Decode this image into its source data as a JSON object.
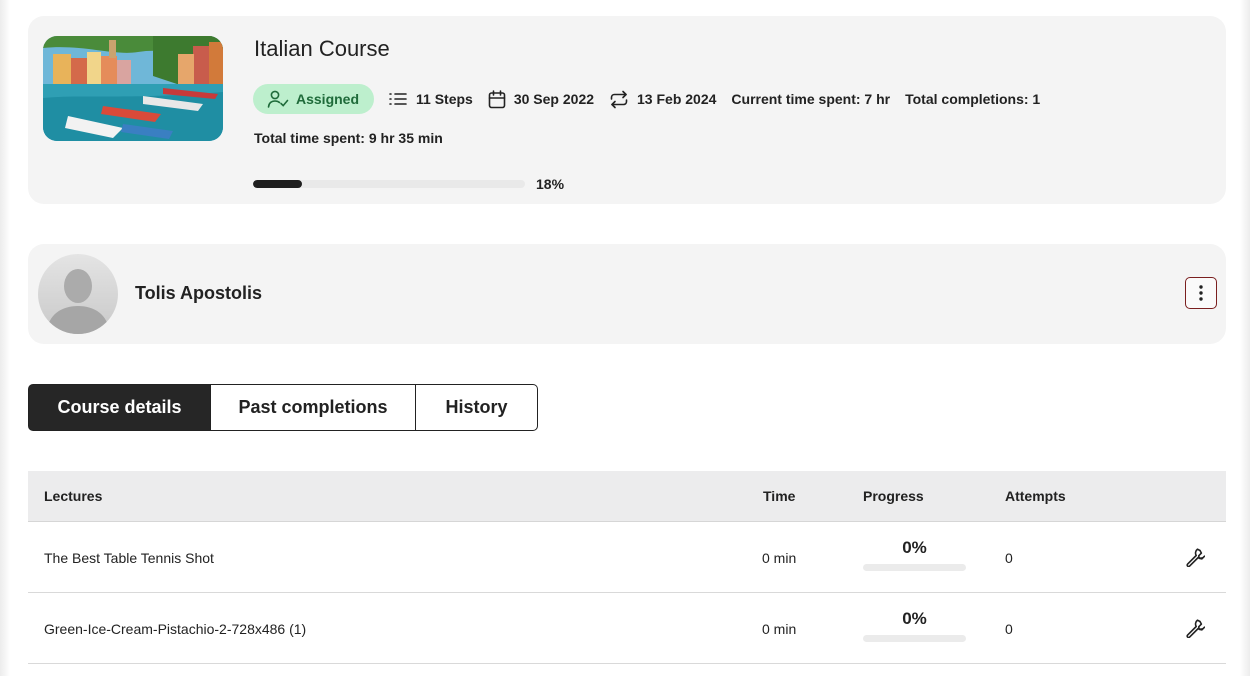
{
  "course": {
    "title": "Italian Course",
    "status_badge": "Assigned",
    "steps": "11 Steps",
    "start_date": "30 Sep 2022",
    "renew_date": "13 Feb 2024",
    "current_time_spent": "Current time spent: 7 hr",
    "total_completions": "Total completions: 1",
    "total_time_spent": "Total time spent: 9 hr 35 min",
    "progress_percent": 18,
    "progress_label": "18%",
    "icons": [
      "user-check-icon",
      "list-icon",
      "calendar-icon",
      "repeat-icon"
    ],
    "badge_color": "#bdefcd"
  },
  "user": {
    "name": "Tolis Apostolis",
    "menu_icon": "kebab-menu-icon"
  },
  "tabs": [
    {
      "label": "Course details",
      "active": true
    },
    {
      "label": "Past completions",
      "active": false
    },
    {
      "label": "History",
      "active": false
    }
  ],
  "table": {
    "headers": {
      "lectures": "Lectures",
      "time": "Time",
      "progress": "Progress",
      "attempts": "Attempts"
    },
    "rows": [
      {
        "name": "The Best Table Tennis Shot",
        "time": "0 min",
        "progress": "0%",
        "progress_value": 0,
        "attempts": "0",
        "action_icon": "wrench-icon"
      },
      {
        "name": "Green-Ice-Cream-Pistachio-2-728x486 (1)",
        "time": "0 min",
        "progress": "0%",
        "progress_value": 0,
        "attempts": "0",
        "action_icon": "wrench-icon"
      }
    ]
  }
}
